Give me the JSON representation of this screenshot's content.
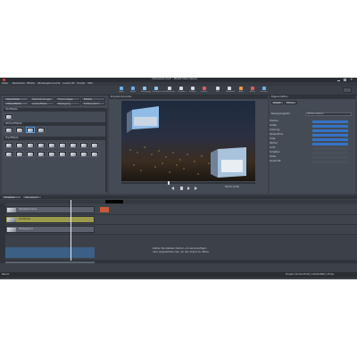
{
  "window": {
    "title": "Unbenannt.mvd* - MAGIX Video deluxe",
    "controls": [
      "minimize",
      "maximize",
      "close"
    ]
  },
  "menu": [
    "Datei",
    "Bearbeiten",
    "Effekte",
    "Wiedergabe",
    "Ansicht",
    "Ausschnitt",
    "Fenster",
    "Hilfe"
  ],
  "toolbar": [
    {
      "label": "Import",
      "icon": "import-icon",
      "color": "#6fb1e8"
    },
    {
      "label": "Export",
      "icon": "export-icon",
      "color": "#6fb1e8"
    },
    {
      "label": "Rückgängig",
      "icon": "undo-icon",
      "color": "#8fc7f0"
    },
    {
      "label": "Wiederherstellen",
      "icon": "redo-icon",
      "color": "#8fc7f0"
    },
    {
      "label": "Mauszeiger",
      "icon": "pointer-icon",
      "color": "#d7dbe0"
    },
    {
      "label": "Schneiden",
      "icon": "cut-icon",
      "color": "#d7dbe0"
    },
    {
      "label": "Einfügen",
      "icon": "insert-icon",
      "color": "#d7dbe0"
    },
    {
      "label": "Löschen",
      "icon": "delete-icon",
      "color": "#e45b5b"
    },
    {
      "label": "Titel",
      "icon": "title-icon",
      "color": "#d7dbe0"
    },
    {
      "label": "Überblende",
      "icon": "transition-icon",
      "color": "#d7dbe0"
    },
    {
      "label": "Audio",
      "icon": "audio-icon",
      "color": "#e89c4b"
    },
    {
      "label": "Effekte",
      "icon": "fx-icon",
      "color": "#e45b5b"
    },
    {
      "label": "Brennen",
      "icon": "burn-icon",
      "color": "#6fb1e8"
    }
  ],
  "left_panel": {
    "tabs_top": [
      "Importieren",
      "Überblendungen",
      "Titelvorlagen",
      "Effekte"
    ],
    "tabs_sub": [
      "Videoeffekte",
      "Audioeffekte",
      "Bewegung",
      "Farbkorrektur"
    ],
    "group1": "3D-Effekte",
    "group2": "Würfel-Effekte",
    "group3": "Flip-Effekte"
  },
  "preview": {
    "title": "Programmmonitor",
    "timecode": "00:00:12:08"
  },
  "right_panel": {
    "title": "Eigenschaften",
    "tabs": [
      "Objekt",
      "Effekte"
    ],
    "rows": [
      "Position",
      "Größe",
      "Drehung",
      "Perspektive",
      "Tiefe",
      "Würfel",
      "Licht",
      "Schatten",
      "Farbe",
      "Deckkraft"
    ],
    "preset_label": "Bewegungspfad",
    "preset_value": "Würfel drehen"
  },
  "timeline": {
    "tabs": [
      "Timeline",
      "Storyboard"
    ],
    "tracks": [
      {
        "label": "Spur 1",
        "clip": "Stadtpanorama"
      },
      {
        "label": "Spur 2",
        "clip": "3D-Würfel"
      },
      {
        "label": "Spur 3",
        "clip": "Hintergrund"
      }
    ],
    "drop_hint": "Ziehen Sie Dateien hierher, um sie einzufügen",
    "drop_hint2": "oder doppelklicken Sie, um den Import zu öffnen"
  },
  "statusbar": {
    "left": "Bereit",
    "right": "Projekt: 00:01:25:00 | 1920x1080 | 25 fps"
  }
}
